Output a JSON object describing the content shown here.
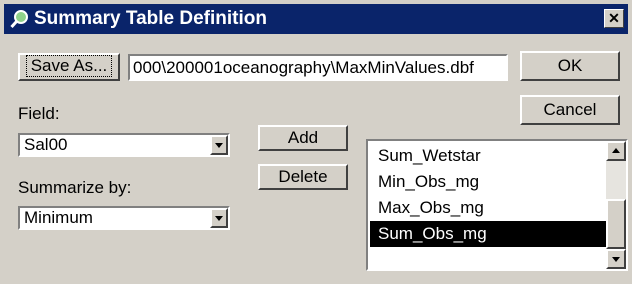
{
  "window": {
    "title": "Summary Table Definition",
    "close_glyph": "✕",
    "icon": "magnifier-icon"
  },
  "output": {
    "save_as_label": "Save As...",
    "path_value": "000\\200001oceanography\\MaxMinValues.dbf"
  },
  "buttons": {
    "ok": "OK",
    "cancel": "Cancel",
    "add": "Add",
    "delete": "Delete"
  },
  "field": {
    "label": "Field:",
    "value": "Sal00"
  },
  "summarize": {
    "label": "Summarize by:",
    "value": "Minimum"
  },
  "summary_list": {
    "items": [
      "Sum_Wetstar",
      "Min_Obs_mg",
      "Max_Obs_mg",
      "Sum_Obs_mg"
    ],
    "selected": "Sum_Obs_mg"
  },
  "colors": {
    "titlebar": "#0a246a",
    "dialog_bg": "#d4d0c8",
    "selection": "#000000"
  }
}
